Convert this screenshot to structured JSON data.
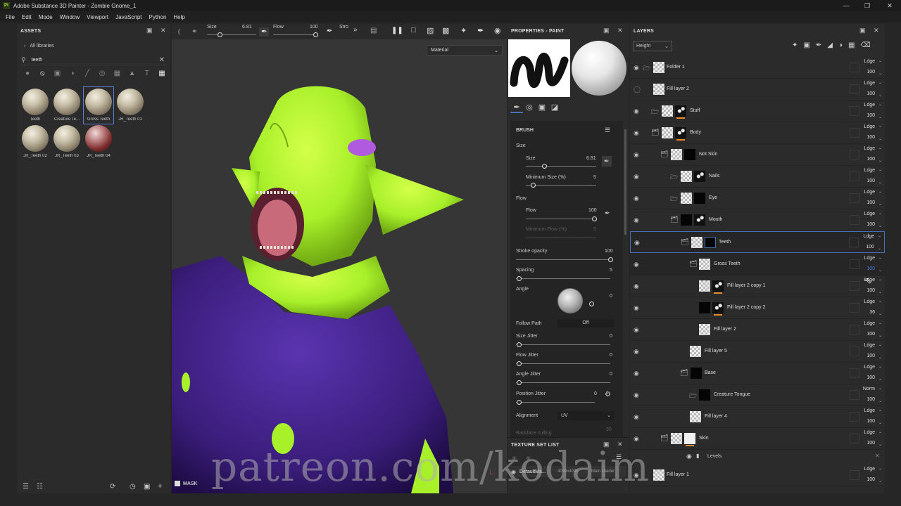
{
  "app": {
    "title": "Adobe Substance 3D Painter - Zombie Gnome_1",
    "logo": "Pt"
  },
  "menu": [
    "File",
    "Edit",
    "Mode",
    "Window",
    "Viewport",
    "JavaScript",
    "Python",
    "Help"
  ],
  "assets": {
    "title": "ASSETS",
    "library": "All libraries",
    "search_value": "teeth",
    "items": [
      {
        "label": "Teeth",
        "icon": "material-ball"
      },
      {
        "label": "Creature Te...",
        "icon": "material-ball"
      },
      {
        "label": "Gross Teeth",
        "icon": "material-ball"
      },
      {
        "label": "JR_Teeth 01",
        "icon": "material-ball"
      },
      {
        "label": "JR_Teeth 02",
        "icon": "material-ball"
      },
      {
        "label": "JR_Teeth 03",
        "icon": "material-ball"
      },
      {
        "label": "JR_Teeth 04",
        "icon": "material-ball-red"
      }
    ]
  },
  "toolbar": {
    "size_label": "Size",
    "size_value": "6.81",
    "flow_label": "Flow",
    "flow_value": "100",
    "stroke_label": "Stro"
  },
  "viewport": {
    "mode": "Material",
    "mask_label": "MASK",
    "watermark": "patreon.com/kodaim"
  },
  "properties": {
    "title": "PROPERTIES - PAINT",
    "brush_title": "BRUSH",
    "size_section": "Size",
    "size_label": "Size",
    "size_value": "6.81",
    "min_size_label": "Minimum Size (%)",
    "min_size_value": "5",
    "flow_section": "Flow",
    "flow_label": "Flow",
    "flow_value": "100",
    "min_flow_label": "Minimum Flow (%)",
    "min_flow_value": "5",
    "stroke_opacity_label": "Stroke opacity",
    "stroke_opacity_value": "100",
    "spacing_label": "Spacing",
    "spacing_value": "5",
    "angle_label": "Angle",
    "angle_value": "0",
    "follow_path_label": "Follow Path",
    "follow_path_value": "Off",
    "size_jitter_label": "Size Jitter",
    "size_jitter_value": "0",
    "flow_jitter_label": "Flow Jitter",
    "flow_jitter_value": "0",
    "angle_jitter_label": "Angle Jitter",
    "angle_jitter_value": "0",
    "position_jitter_label": "Position Jitter",
    "position_jitter_value": "0",
    "alignment_label": "Alignment",
    "alignment_value": "UV",
    "backface_label": "Backface culling",
    "backface_value": "90"
  },
  "texture_set_list": {
    "title": "TEXTURE SET LIST",
    "set_name": "DefaultMa...",
    "resolution": "4096x4096",
    "shader": "Main shader"
  },
  "layers_panel": {
    "title": "LAYERS",
    "channel": "Height",
    "layers": [
      {
        "name": "Folder 1",
        "blend": "Ldge",
        "opacity": "100",
        "indent": 0,
        "folder": true
      },
      {
        "name": "Fill layer 2",
        "blend": "Ldge",
        "opacity": "100",
        "indent": 0,
        "folder": false
      },
      {
        "name": "Stuff",
        "blend": "Ldge",
        "opacity": "100",
        "indent": 0,
        "folder": true
      },
      {
        "name": "Body",
        "blend": "Ldge",
        "opacity": "100",
        "indent": 0,
        "folder": true
      },
      {
        "name": "Not Skin",
        "blend": "Ldge",
        "opacity": "100",
        "indent": 1,
        "folder": true
      },
      {
        "name": "Nails",
        "blend": "Ldge",
        "opacity": "100",
        "indent": 2,
        "folder": true
      },
      {
        "name": "Eye",
        "blend": "Ldge",
        "opacity": "100",
        "indent": 2,
        "folder": true
      },
      {
        "name": "Mouth",
        "blend": "Ldge",
        "opacity": "100",
        "indent": 2,
        "folder": true
      },
      {
        "name": "Teeth",
        "blend": "Ldge",
        "opacity": "100",
        "indent": 3,
        "folder": true
      },
      {
        "name": "Gross Teeth",
        "blend": "Ldge",
        "opacity": "100",
        "indent": 4,
        "folder": true
      },
      {
        "name": "Fill layer 2 copy 1",
        "blend": "Ldge",
        "opacity": "100",
        "indent": 5,
        "folder": false
      },
      {
        "name": "Fill layer 2 copy 2",
        "blend": "Ldge",
        "opacity": "36",
        "indent": 5,
        "folder": false
      },
      {
        "name": "Fill layer 2",
        "blend": "Ldge",
        "opacity": "100",
        "indent": 4,
        "folder": false
      },
      {
        "name": "Fill layer 5",
        "blend": "Ldge",
        "opacity": "100",
        "indent": 3,
        "folder": false
      },
      {
        "name": "Base",
        "blend": "Ldge",
        "opacity": "100",
        "indent": 3,
        "folder": true
      },
      {
        "name": "Creature Tongue",
        "blend": "Norm",
        "opacity": "100",
        "indent": 4,
        "folder": true
      },
      {
        "name": "Fill layer 4",
        "blend": "Ldge",
        "opacity": "100",
        "indent": 4,
        "folder": false
      },
      {
        "name": "Skin",
        "blend": "Ldge",
        "opacity": "100",
        "indent": 1,
        "folder": true
      },
      {
        "name": "Levels",
        "blend": "",
        "opacity": "",
        "indent": 2,
        "folder": false
      },
      {
        "name": "Fill layer 1",
        "blend": "Ldge",
        "opacity": "100",
        "indent": 0,
        "folder": false
      }
    ]
  },
  "colors": {
    "accent": "#4a6fb8",
    "skin": "#a8f02a",
    "shirt": "#3a1d7a",
    "eye": "#b05ae0",
    "mouth": "#c96a7a",
    "orange": "#e88a2a"
  }
}
